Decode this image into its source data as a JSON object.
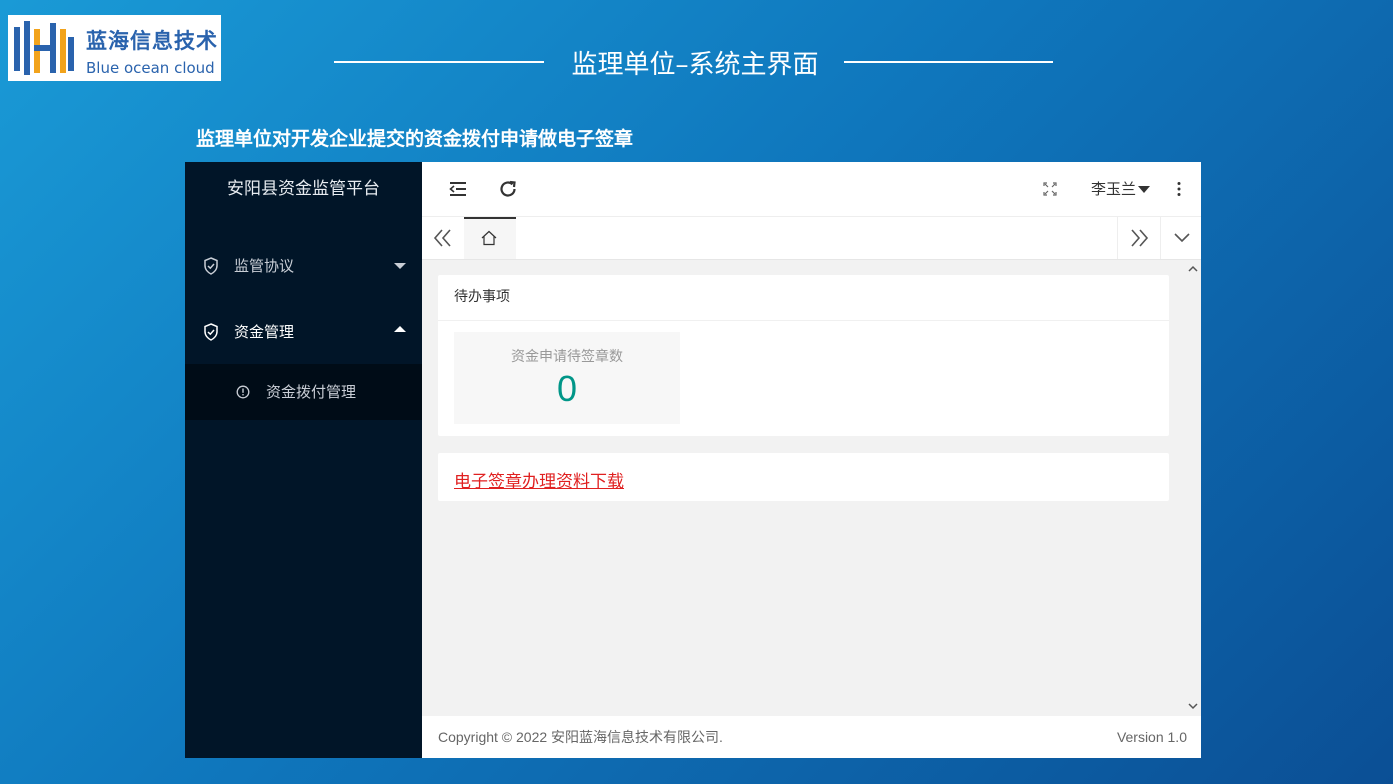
{
  "logo": {
    "name_cn": "蓝海信息技术",
    "name_en": "Blue ocean cloud"
  },
  "headline": "监理单位–系统主界面",
  "subheading": "监理单位对开发企业提交的资金拨付申请做电子签章",
  "app": {
    "brand": "安阳县资金监管平台",
    "sidebar": {
      "items": [
        {
          "label": "监管协议",
          "icon": "shield-check-icon",
          "expanded": false
        },
        {
          "label": "资金管理",
          "icon": "shield-check-icon",
          "expanded": true
        }
      ],
      "subitems": [
        {
          "label": "资金拨付管理",
          "icon": "info-circle-icon"
        }
      ]
    },
    "topbar": {
      "user": "李玉兰"
    },
    "todo": {
      "title": "待办事项",
      "stat_label": "资金申请待签章数",
      "stat_value": "0"
    },
    "download_link": "电子签章办理资料下载",
    "footer": {
      "copyright": "Copyright © 2022 安阳蓝海信息技术有限公司.",
      "version": "Version 1.0"
    }
  },
  "colors": {
    "accent": "#009688",
    "sidebar_bg": "#011528",
    "link": "#e02020"
  }
}
